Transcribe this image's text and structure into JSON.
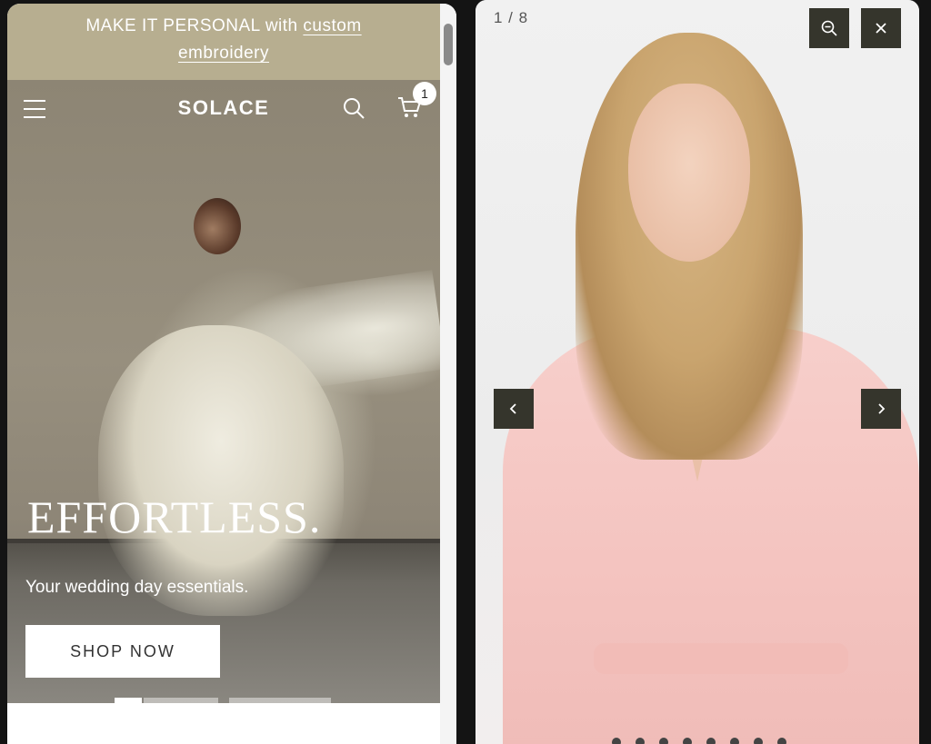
{
  "store": {
    "announcement": {
      "prefix": "MAKE IT PERSONAL with",
      "link_text": "custom",
      "link_text_2": "embroidery"
    },
    "brand": "SOLACE",
    "cart_count": "1",
    "hero": {
      "title": "EFFORTLESS.",
      "subtitle": "Your wedding day essentials.",
      "cta_label": "SHOP NOW"
    },
    "slides": {
      "count": 3,
      "active": 0
    },
    "icons": {
      "menu": "hamburger-menu-icon",
      "search": "search-icon",
      "cart": "cart-icon"
    },
    "colors": {
      "announcement_bg": "#b7ae90",
      "button_bg": "#ffffff"
    }
  },
  "lightbox": {
    "counter": "1 / 8",
    "icons": {
      "zoom": "zoom-out-icon",
      "close": "close-icon",
      "prev": "chevron-left-icon",
      "next": "chevron-right-icon"
    },
    "dots": {
      "count": 8,
      "active": 0
    },
    "colors": {
      "control_bg": "#35352c"
    }
  }
}
